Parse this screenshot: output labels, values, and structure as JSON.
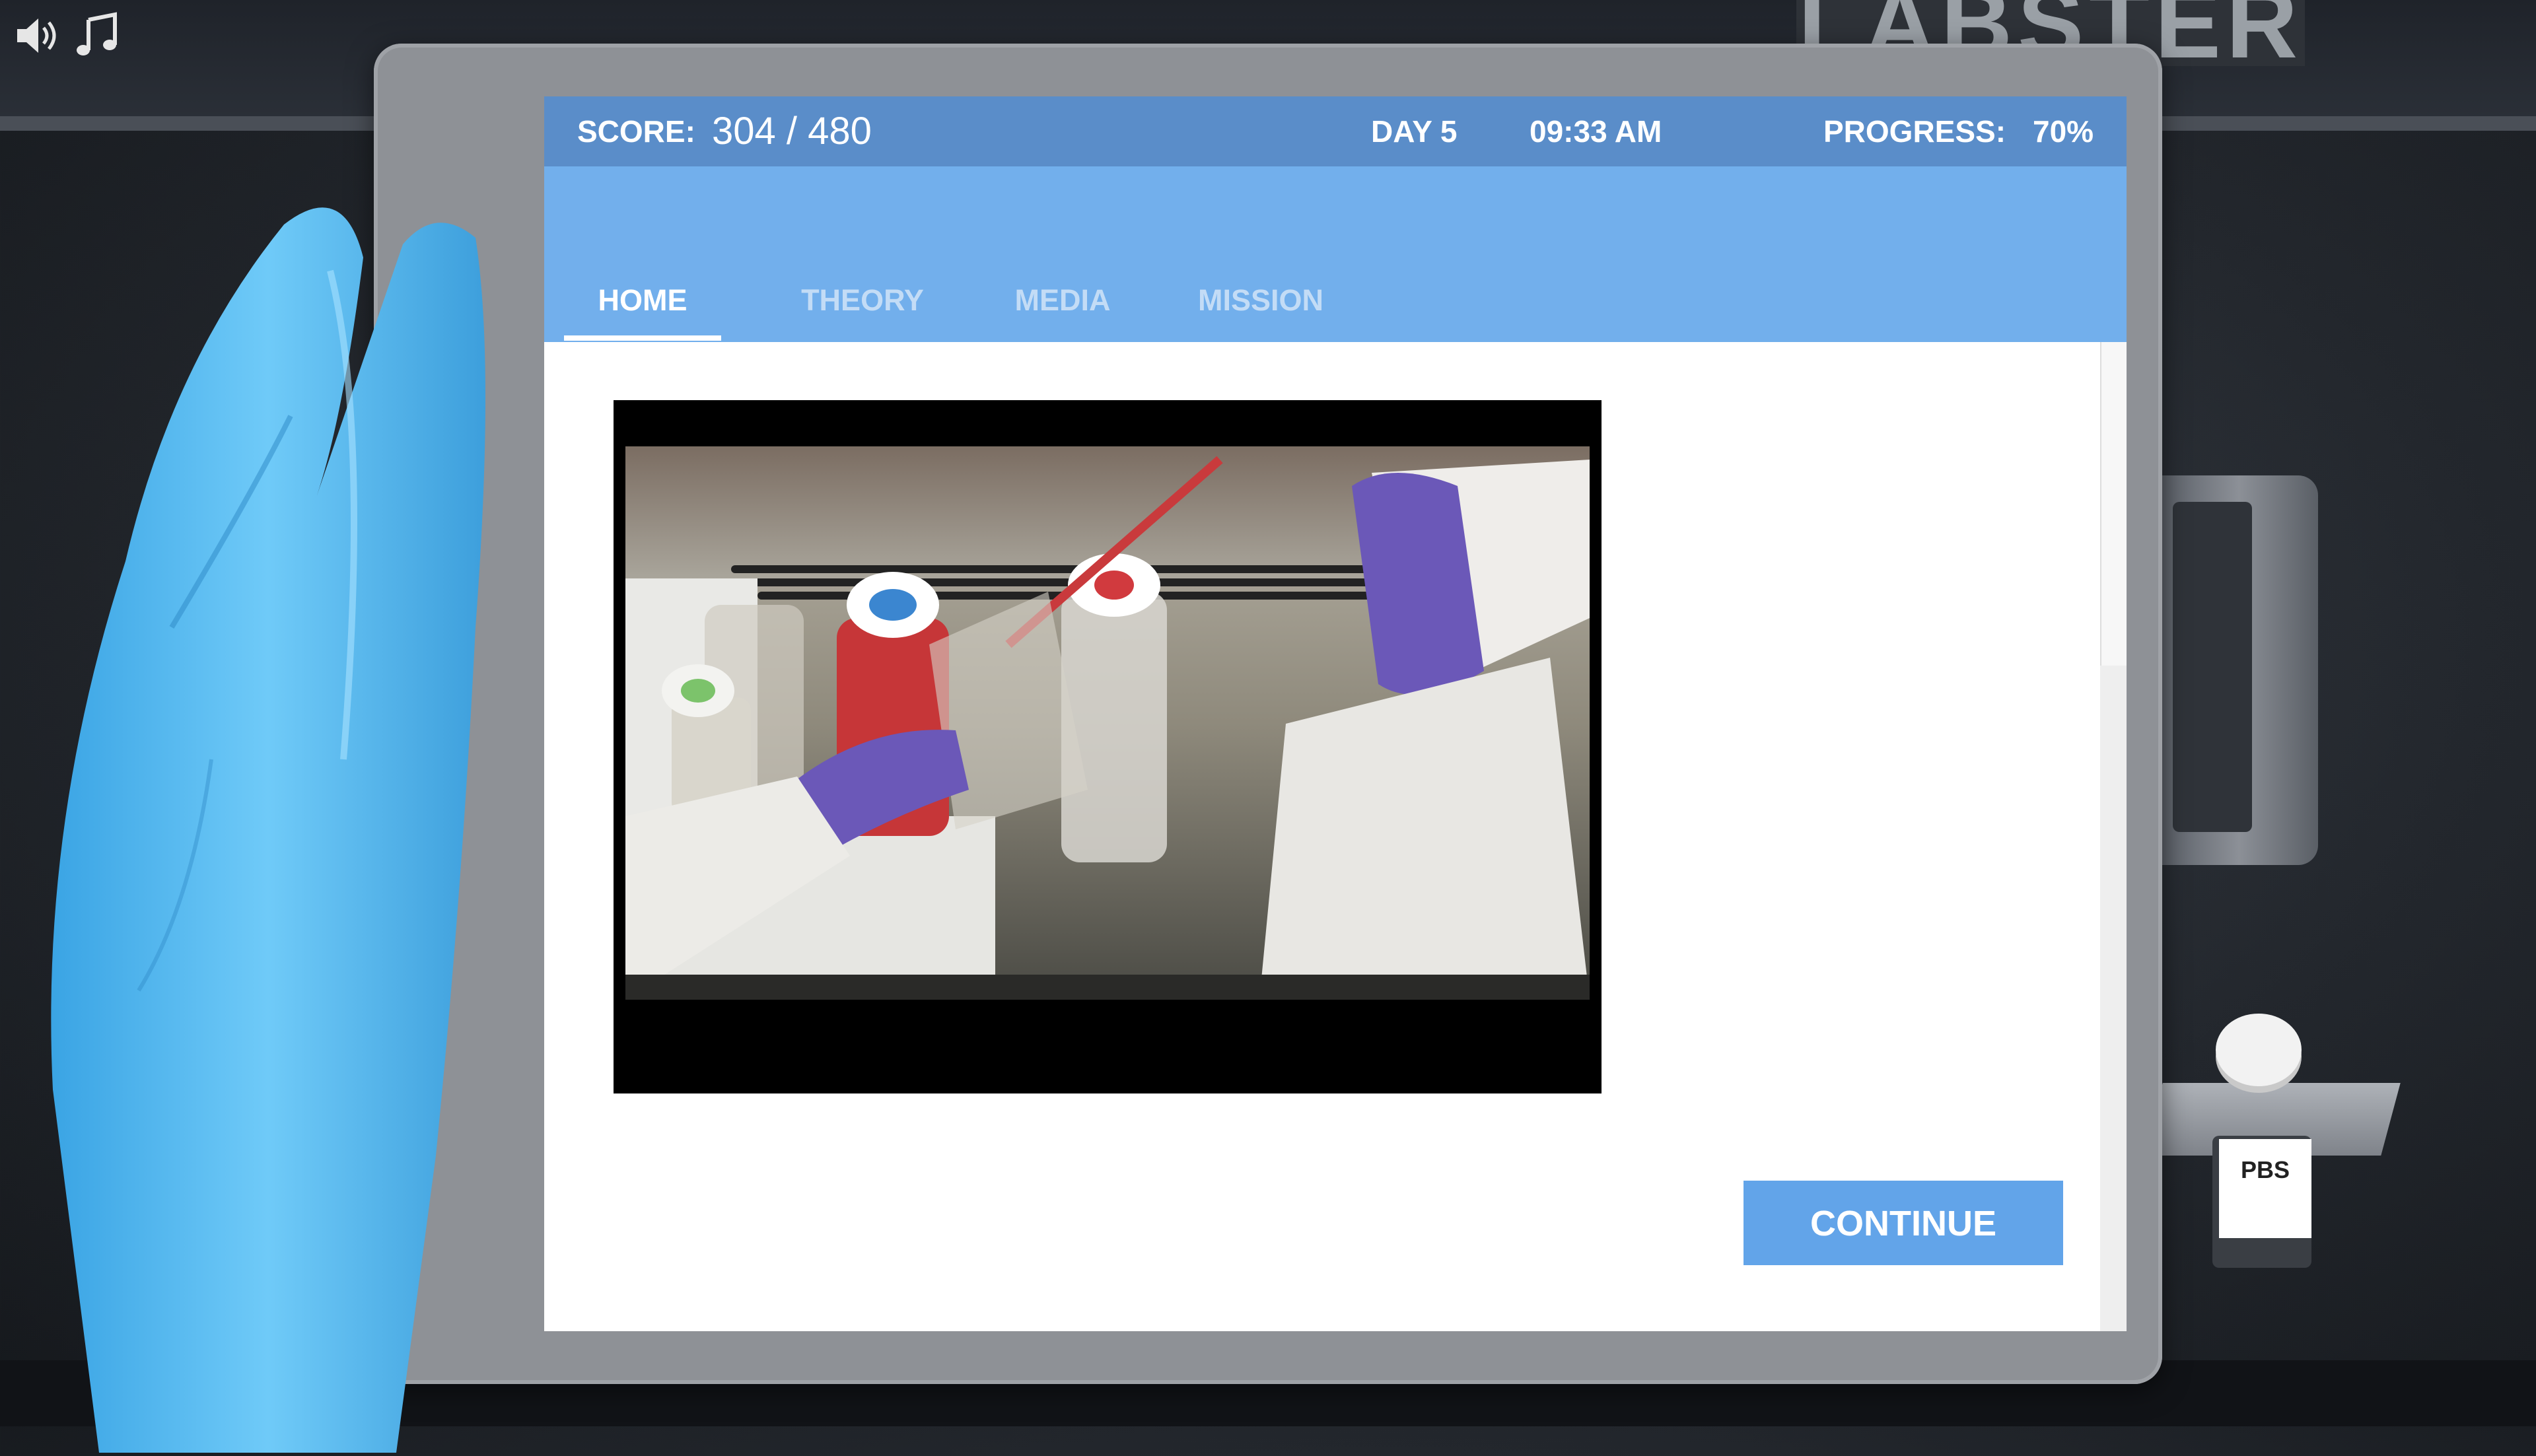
{
  "window": {
    "sign_text": "LABSTER"
  },
  "header": {
    "score_label": "SCORE:",
    "score_value": "304 / 480",
    "day": "DAY 5",
    "time": "09:33 AM",
    "progress_label": "PROGRESS:",
    "progress_value": "70%"
  },
  "tabs": [
    {
      "label": "HOME",
      "active": true
    },
    {
      "label": "THEORY",
      "active": false
    },
    {
      "label": "MEDIA",
      "active": false
    },
    {
      "label": "MISSION",
      "active": false
    }
  ],
  "actions": {
    "continue_label": "CONTINUE"
  },
  "scene": {
    "bottle_label": "PBS"
  },
  "icons": [
    "speaker-icon",
    "music-note-icon"
  ],
  "colors": {
    "header_bg": "#5a8dc9",
    "tab_bg": "#72afec",
    "button_bg": "#62a4e9",
    "tab_inactive": "#c3dcf6"
  }
}
